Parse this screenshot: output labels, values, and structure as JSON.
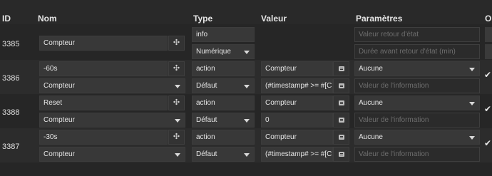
{
  "header": {
    "id": "ID",
    "nom": "Nom",
    "type": "Type",
    "valeur": "Valeur",
    "parametres": "Paramètres",
    "options": "Op"
  },
  "rows": [
    {
      "id": "3385",
      "name": "Compteur",
      "type": "info",
      "subtype": "Numérique",
      "param1_placeholder": "Valeur retour d'état",
      "param2_placeholder": "Durée avant retour d'état (min)"
    },
    {
      "id": "3386",
      "name": "-60s",
      "type": "action",
      "subtype": "Défaut",
      "group": "Compteur",
      "value1": "Compteur",
      "value2": "(#timestamp# >= #[Chi",
      "param": "Aucune",
      "param2_placeholder": "Valeur de l'information",
      "checked": true
    },
    {
      "id": "3388",
      "name": "Reset",
      "type": "action",
      "subtype": "Défaut",
      "group": "Compteur",
      "value1": "Compteur",
      "value2": "0",
      "param": "Aucune",
      "param2_placeholder": "Valeur de l'information",
      "checked": true
    },
    {
      "id": "3387",
      "name": "-30s",
      "type": "action",
      "subtype": "Défaut",
      "group": "Compteur",
      "value1": "Compteur",
      "value2": "(#timestamp# >= #[Chi",
      "param": "Aucune",
      "param2_placeholder": "Valeur de l'information",
      "checked": true
    }
  ],
  "icons": {
    "configure": "gear-icon",
    "edit": "list-icon",
    "check": "check-icon"
  },
  "colors": {
    "background": "#262626",
    "field": "#383838",
    "text": "#e5e5e5",
    "placeholder": "#6e6e6e"
  }
}
